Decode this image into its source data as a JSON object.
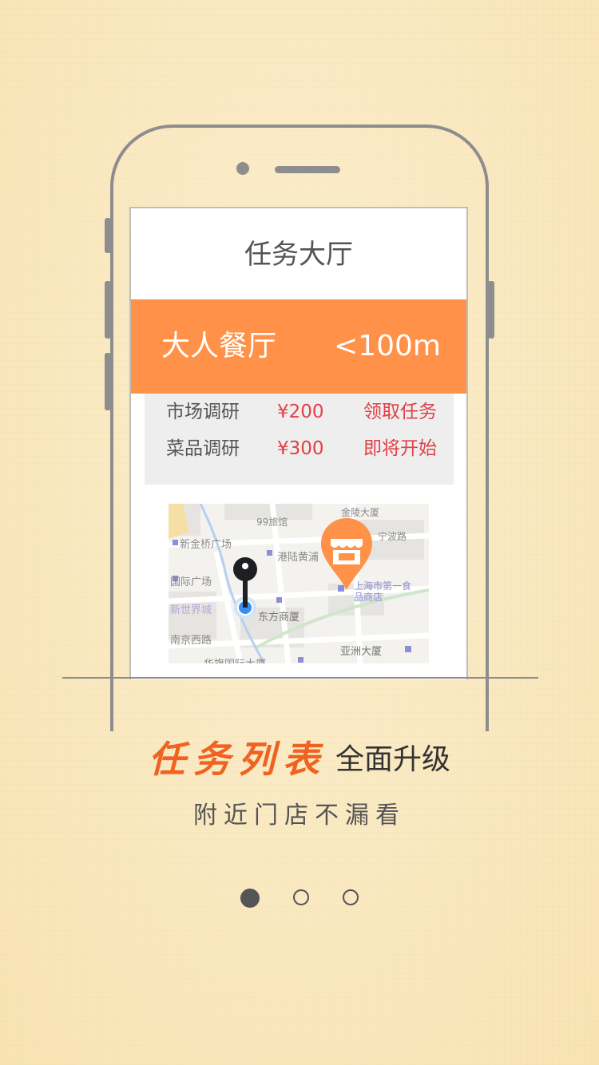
{
  "screen": {
    "title": "任务大厅",
    "shop": {
      "name": "大人餐厅",
      "distance": "<100m"
    },
    "tasks": [
      {
        "name": "市场调研",
        "price": "¥200",
        "action": "领取任务"
      },
      {
        "name": "菜品调研",
        "price": "¥300",
        "action": "即将开始"
      }
    ],
    "map": {
      "labels": [
        "99旅馆",
        "新金桥广场",
        "港陆黄浦",
        "国际广场",
        "新世界城",
        "东方商厦",
        "南京西路",
        "上海市第一食品商店",
        "亚洲大厦",
        "宁波路",
        "华旗国际大厦",
        "金陵大厦"
      ],
      "icons": [
        "location-pin-icon",
        "store-marker-icon"
      ]
    }
  },
  "headline": {
    "highlight": "任务列表",
    "rest": "全面升级"
  },
  "subtitle": "附近门店不漏看",
  "pager": {
    "count": 3,
    "active": 1
  },
  "colors": {
    "accent": "#ff9148",
    "price": "#e0414a",
    "highlight": "#f0621f",
    "background": "#fbebc3"
  }
}
